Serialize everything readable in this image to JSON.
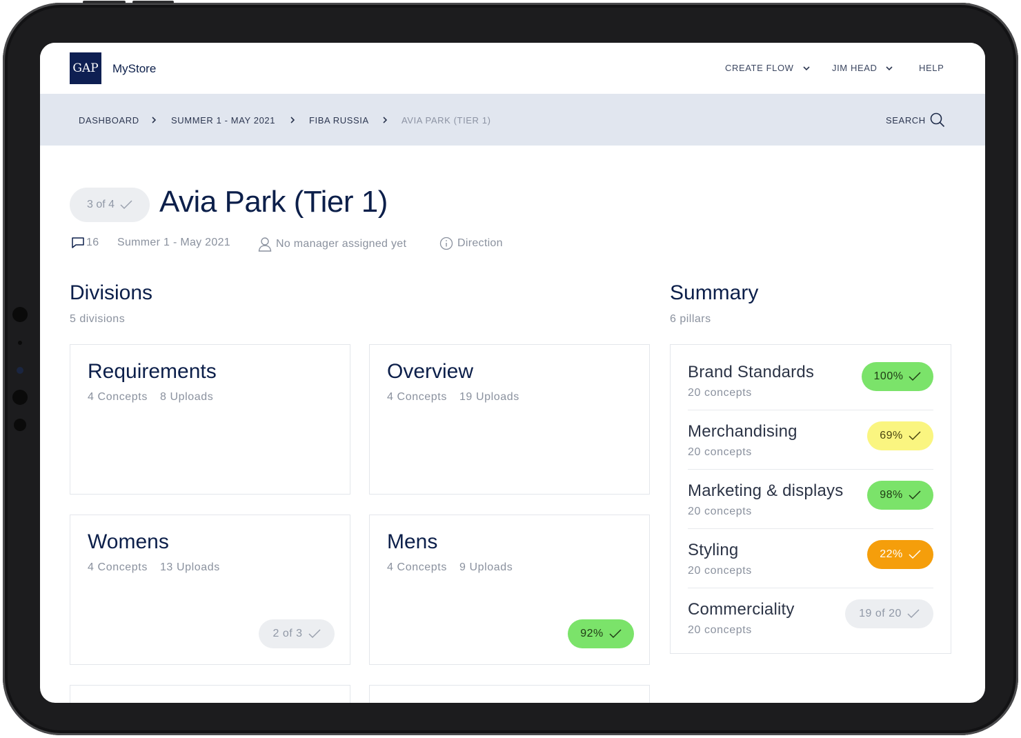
{
  "app": {
    "logo_text": "GAP",
    "name": "MyStore"
  },
  "nav": {
    "create_flow": "CREATE FLOW",
    "user": "JIM HEAD",
    "help": "HELP"
  },
  "breadcrumb": {
    "items": [
      "DASHBOARD",
      "SUMMER 1 - MAY 2021",
      "FIBA RUSSIA",
      "AVIA PARK (TIER 1)"
    ],
    "search_label": "SEARCH"
  },
  "store": {
    "progress": "3 of 4",
    "title": "Avia Park (Tier 1)",
    "comments_count": "16",
    "season": "Summer 1 - May 2021",
    "manager": "No manager assigned yet",
    "direction": "Direction"
  },
  "divisions": {
    "title": "Divisions",
    "subtitle": "5 divisions",
    "cards": [
      {
        "name": "Requirements",
        "concepts": "4 Concepts",
        "uploads": "8 Uploads",
        "badge": "",
        "badge_color": ""
      },
      {
        "name": "Overview",
        "concepts": "4 Concepts",
        "uploads": "19 Uploads",
        "badge": "",
        "badge_color": ""
      },
      {
        "name": "Womens",
        "concepts": "4 Concepts",
        "uploads": "13 Uploads",
        "badge": "2 of 3",
        "badge_color": "#eceef1"
      },
      {
        "name": "Mens",
        "concepts": "4 Concepts",
        "uploads": "9 Uploads",
        "badge": "92%",
        "badge_color": "#7be36a"
      }
    ]
  },
  "summary": {
    "title": "Summary",
    "subtitle": "6 pillars",
    "pillars": [
      {
        "name": "Brand Standards",
        "sub": "20 concepts",
        "badge": "100%",
        "color": "#7be36a"
      },
      {
        "name": "Merchandising",
        "sub": "20 concepts",
        "badge": "69%",
        "color": "#faf580"
      },
      {
        "name": "Marketing & displays",
        "sub": "20 concepts",
        "badge": "98%",
        "color": "#7be36a"
      },
      {
        "name": "Styling",
        "sub": "20 concepts",
        "badge": "22%",
        "color": "#f59e0b"
      },
      {
        "name": "Commerciality",
        "sub": "20 concepts",
        "badge": "19 of 20",
        "color": "#eceef1"
      }
    ]
  },
  "colors": {
    "navy": "#0e1f52",
    "crumb_bg": "#e1e6ef",
    "green": "#7be36a",
    "yellow": "#faf580",
    "orange": "#f59e0b",
    "grey_pill": "#eceef1"
  }
}
